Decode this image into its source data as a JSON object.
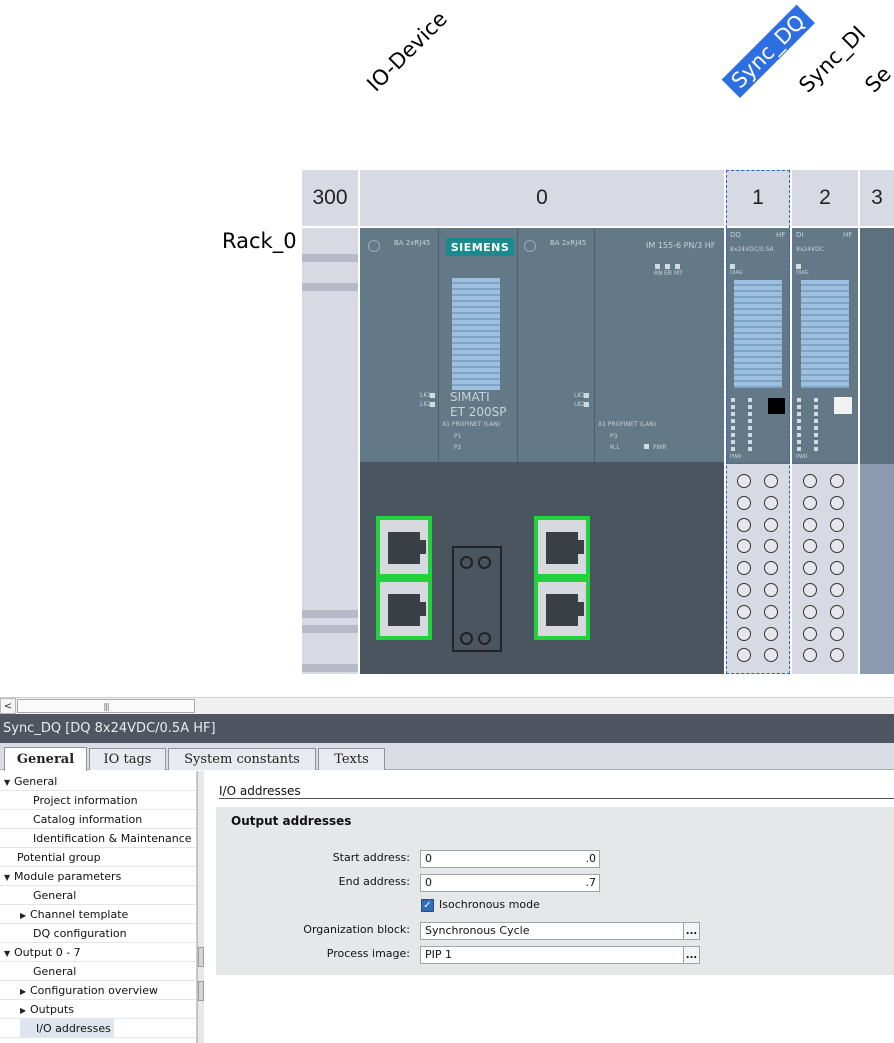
{
  "device_view": {
    "column_labels": [
      "IO-Device",
      "Sync_DQ",
      "Sync_DI",
      "Se"
    ],
    "selected_column": "Sync_DQ",
    "slots": [
      "300",
      "0",
      "1",
      "2",
      "3"
    ],
    "rack_name": "Rack_0",
    "interface_module": {
      "brand": "SIEMENS",
      "product_line1": "SIMATI",
      "product_line2": "ET 200SP",
      "type": "IM 155-6 PN/3 HF",
      "ba_left": "BA 2xRJ45",
      "ba_right": "BA 2xRJ45",
      "led_rn": "RN",
      "led_er": "ER",
      "led_mt": "MT",
      "profinet_left": "X1 PROFINET (LAN)",
      "profinet_right": "X1 PROFINET (LAN)",
      "p1": "P1",
      "p2": "P2",
      "p3": "P3",
      "nl": "N.L",
      "pwr": "PWR",
      "lk1": "LK1",
      "lk2": "LK2"
    },
    "module_dq": {
      "top_left": "DQ",
      "top_right": "HF",
      "type": "8x24VDC/0.5A",
      "diag": "DIAG",
      "pwr": "PWR"
    },
    "module_di": {
      "top_left": "DI",
      "top_right": "HF",
      "type": "8x24VDC",
      "diag": "DIAG",
      "pwr": "PWR"
    },
    "colors": {
      "selection": "#2d6ee0",
      "port_highlight": "#22d23c",
      "module_body": "#647987"
    }
  },
  "scrollbar": {
    "left_arrow": "<",
    "thumb_grip": "|||"
  },
  "inspector": {
    "title": "Sync_DQ [DQ 8x24VDC/0.5A HF]",
    "tabs": [
      {
        "label": "General",
        "active": true
      },
      {
        "label": "IO tags",
        "active": false
      },
      {
        "label": "System constants",
        "active": false
      },
      {
        "label": "Texts",
        "active": false
      }
    ],
    "tree": [
      {
        "label": "General",
        "level": 0,
        "twisty": "down"
      },
      {
        "label": "Project information",
        "level": 1,
        "twisty": ""
      },
      {
        "label": "Catalog information",
        "level": 1,
        "twisty": ""
      },
      {
        "label": "Identification & Maintenance",
        "level": 1,
        "twisty": ""
      },
      {
        "label": "Potential group",
        "level": 0,
        "twisty": ""
      },
      {
        "label": "Module parameters",
        "level": 0,
        "twisty": "down"
      },
      {
        "label": "General",
        "level": 1,
        "twisty": ""
      },
      {
        "label": "Channel template",
        "level": 1,
        "twisty": "right"
      },
      {
        "label": "DQ configuration",
        "level": 1,
        "twisty": ""
      },
      {
        "label": "Output 0 - 7",
        "level": 0,
        "twisty": "down"
      },
      {
        "label": "General",
        "level": 1,
        "twisty": ""
      },
      {
        "label": "Configuration overview",
        "level": 1,
        "twisty": "right"
      },
      {
        "label": "Outputs",
        "level": 1,
        "twisty": "right"
      },
      {
        "label": "I/O addresses",
        "level": 1,
        "twisty": "",
        "selected": true
      }
    ],
    "section": {
      "title": "I/O addresses",
      "group_title": "Output addresses",
      "start_address": {
        "label": "Start address:",
        "value": "0",
        "suffix": ".0"
      },
      "end_address": {
        "label": "End address:",
        "value": "0",
        "suffix": ".7"
      },
      "isochronous": {
        "label": "Isochronous mode",
        "checked": true
      },
      "org_block": {
        "label": "Organization block:",
        "value": "Synchronous Cycle",
        "button": "..."
      },
      "process_image": {
        "label": "Process image:",
        "value": "PIP 1",
        "button": "..."
      }
    }
  }
}
